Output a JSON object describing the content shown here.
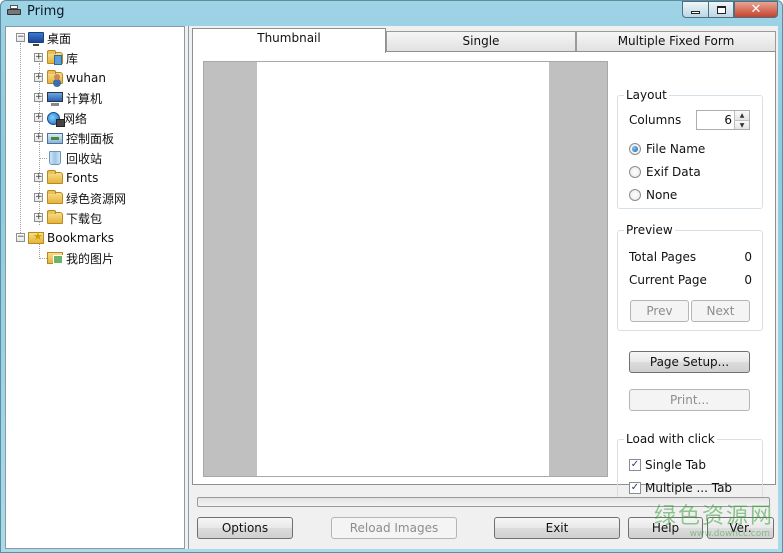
{
  "window": {
    "title": "Primg"
  },
  "tree": {
    "items": [
      {
        "label": "桌面",
        "icon": "desktop-icon"
      },
      {
        "label": "库",
        "icon": "library-folder-icon"
      },
      {
        "label": "wuhan",
        "icon": "user-folder-icon"
      },
      {
        "label": "计算机",
        "icon": "computer-icon"
      },
      {
        "label": "网络",
        "icon": "network-icon"
      },
      {
        "label": "控制面板",
        "icon": "control-panel-icon"
      },
      {
        "label": "回收站",
        "icon": "recycle-bin-icon"
      },
      {
        "label": "Fonts",
        "icon": "folder-icon"
      },
      {
        "label": "绿色资源网",
        "icon": "folder-icon"
      },
      {
        "label": "下载包",
        "icon": "folder-icon"
      },
      {
        "label": "Bookmarks",
        "icon": "bookmark-folder-icon"
      },
      {
        "label": "我的图片",
        "icon": "pictures-folder-icon"
      }
    ]
  },
  "tabs": [
    {
      "label": "Thumbnail",
      "active": true
    },
    {
      "label": "Single",
      "active": false
    },
    {
      "label": "Multiple Fixed Form",
      "active": false
    }
  ],
  "layout": {
    "title": "Layout",
    "columns_label": "Columns",
    "columns_value": "6",
    "options": [
      {
        "label": "File Name",
        "checked": true
      },
      {
        "label": "Exif Data",
        "checked": false
      },
      {
        "label": "None",
        "checked": false
      }
    ]
  },
  "preview": {
    "title": "Preview",
    "total_pages_label": "Total Pages",
    "total_pages_value": "0",
    "current_page_label": "Current Page",
    "current_page_value": "0",
    "prev_label": "Prev",
    "next_label": "Next"
  },
  "actions": {
    "page_setup_label": "Page Setup...",
    "print_label": "Print..."
  },
  "load_with_click": {
    "title": "Load with click",
    "single_tab_label": "Single Tab",
    "single_tab_checked": true,
    "multiple_tab_label": "Multiple ... Tab",
    "multiple_tab_checked": true
  },
  "progress": {
    "value": 0
  },
  "bottom_buttons": {
    "options_label": "Options",
    "reload_label": "Reload Images",
    "exit_label": "Exit",
    "help_label": "Help",
    "ver_label": "Ver."
  },
  "watermark": {
    "text": "绿色资源网",
    "sub": "www.downcc.com"
  },
  "colors": {
    "title_bar": "#9fd3e6",
    "close_button": "#c4432c",
    "radio_accent": "#1a5fa8"
  }
}
